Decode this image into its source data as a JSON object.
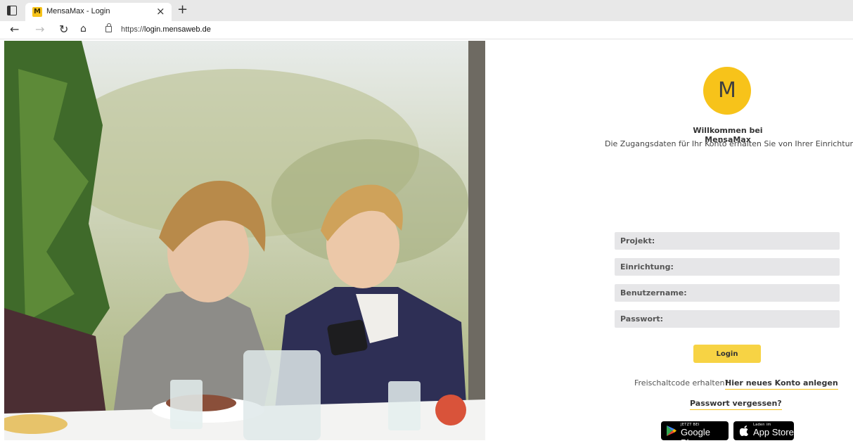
{
  "browser": {
    "tab_title": "MensaMax - Login",
    "tab_favicon_letter": "M",
    "tab_close": "×",
    "new_tab": "+",
    "url_prefix": "https://",
    "url_host": "login.mensaweb.de"
  },
  "login": {
    "logo_letter": "M",
    "welcome_title": "Willkommen bei MensaMax",
    "welcome_subtitle": "Die Zugangsdaten für Ihr Konto erhalten Sie von Ihrer Einrichtung.",
    "fields": {
      "project_placeholder": "Projekt:",
      "facility_placeholder": "Einrichtung:",
      "username_placeholder": "Benutzername:",
      "password_placeholder": "Passwort:"
    },
    "login_button": "Login",
    "activation_text": "Freischaltcode erhalten?",
    "new_account_link": "Hier neues Konto anlegen",
    "forgot_password_link": "Passwort vergessen?",
    "google_play_small": "JETZT BEI",
    "google_play_big": "Google Play",
    "app_store_small": "Laden im",
    "app_store_big": "App Store"
  },
  "colors": {
    "brand_yellow": "#f7c31a",
    "button_yellow": "#f7d344",
    "field_bg": "#e6e6e8"
  }
}
